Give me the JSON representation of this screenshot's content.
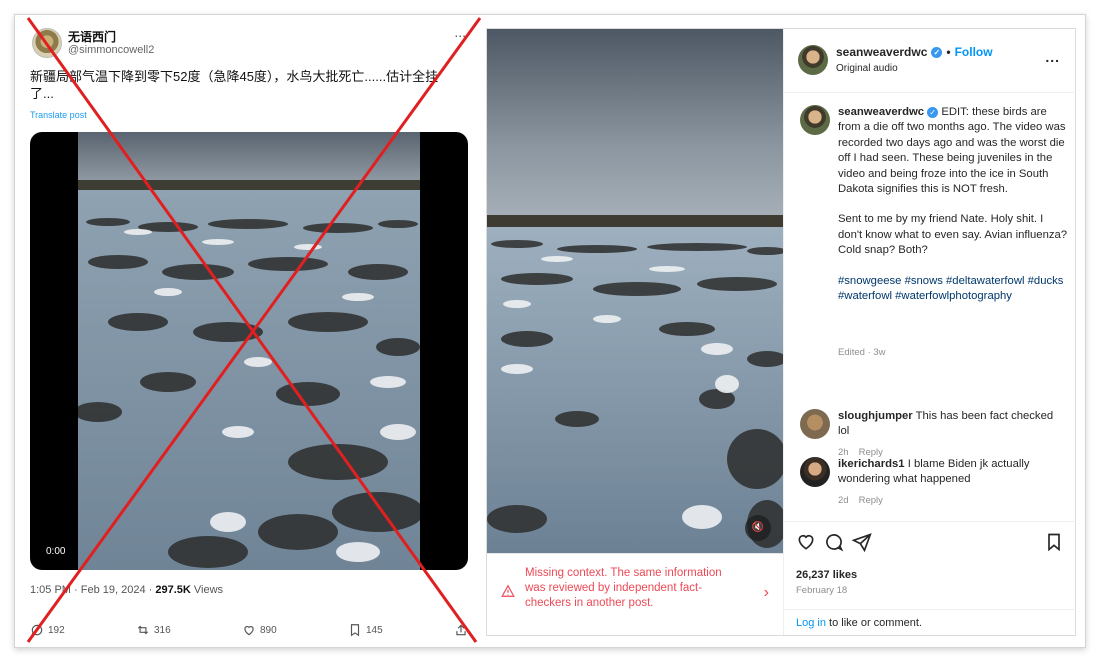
{
  "tweet": {
    "display_name": "无语西门",
    "handle": "@simmoncowell2",
    "more": "...",
    "text": "新疆局部气温下降到零下52度（急降45度），水鸟大批死亡......估计全挂了...",
    "translate": "Translate post",
    "video_time": "0:00",
    "timestamp": "1:05 PM · Feb 19, 2024 · ",
    "views_count": "297.5K",
    "views_label": " Views",
    "replies": "192",
    "reposts": "316",
    "likes": "890",
    "bookmarks": "145"
  },
  "instagram": {
    "username": "seanweaverdwc",
    "separator": "•",
    "follow": "Follow",
    "audio": "Original audio",
    "more": "...",
    "caption": {
      "user": "seanweaverdwc",
      "p1": "EDIT: these birds are from a die off two months ago. The video was recorded two days ago and was the worst die off I had seen. These being juveniles in the video and being froze into the ice in South Dakota signifies this is NOT fresh.",
      "p2": "Sent to me by my friend Nate. Holy shit. I don't know what to even say. Avian influenza? Cold snap? Both?",
      "tags": "#snowgeese #snows #deltawaterfowl #ducks #waterfowl #waterfowlphotography",
      "edited": "Edited · 3w"
    },
    "comments": [
      {
        "user": "sloughjumper",
        "text": "This has been fact checked lol",
        "time": "2h",
        "reply": "Reply"
      },
      {
        "user": "ikerichards1",
        "text": "I blame Biden jk actually wondering what happened",
        "time": "2d",
        "reply": "Reply"
      }
    ],
    "likes": "26,237 likes",
    "date": "February 18",
    "login_link": "Log in",
    "login_rest": " to like or comment.",
    "context": "Missing context. The same information was reviewed by independent fact-checkers in another post.",
    "context_arrow": "›"
  }
}
